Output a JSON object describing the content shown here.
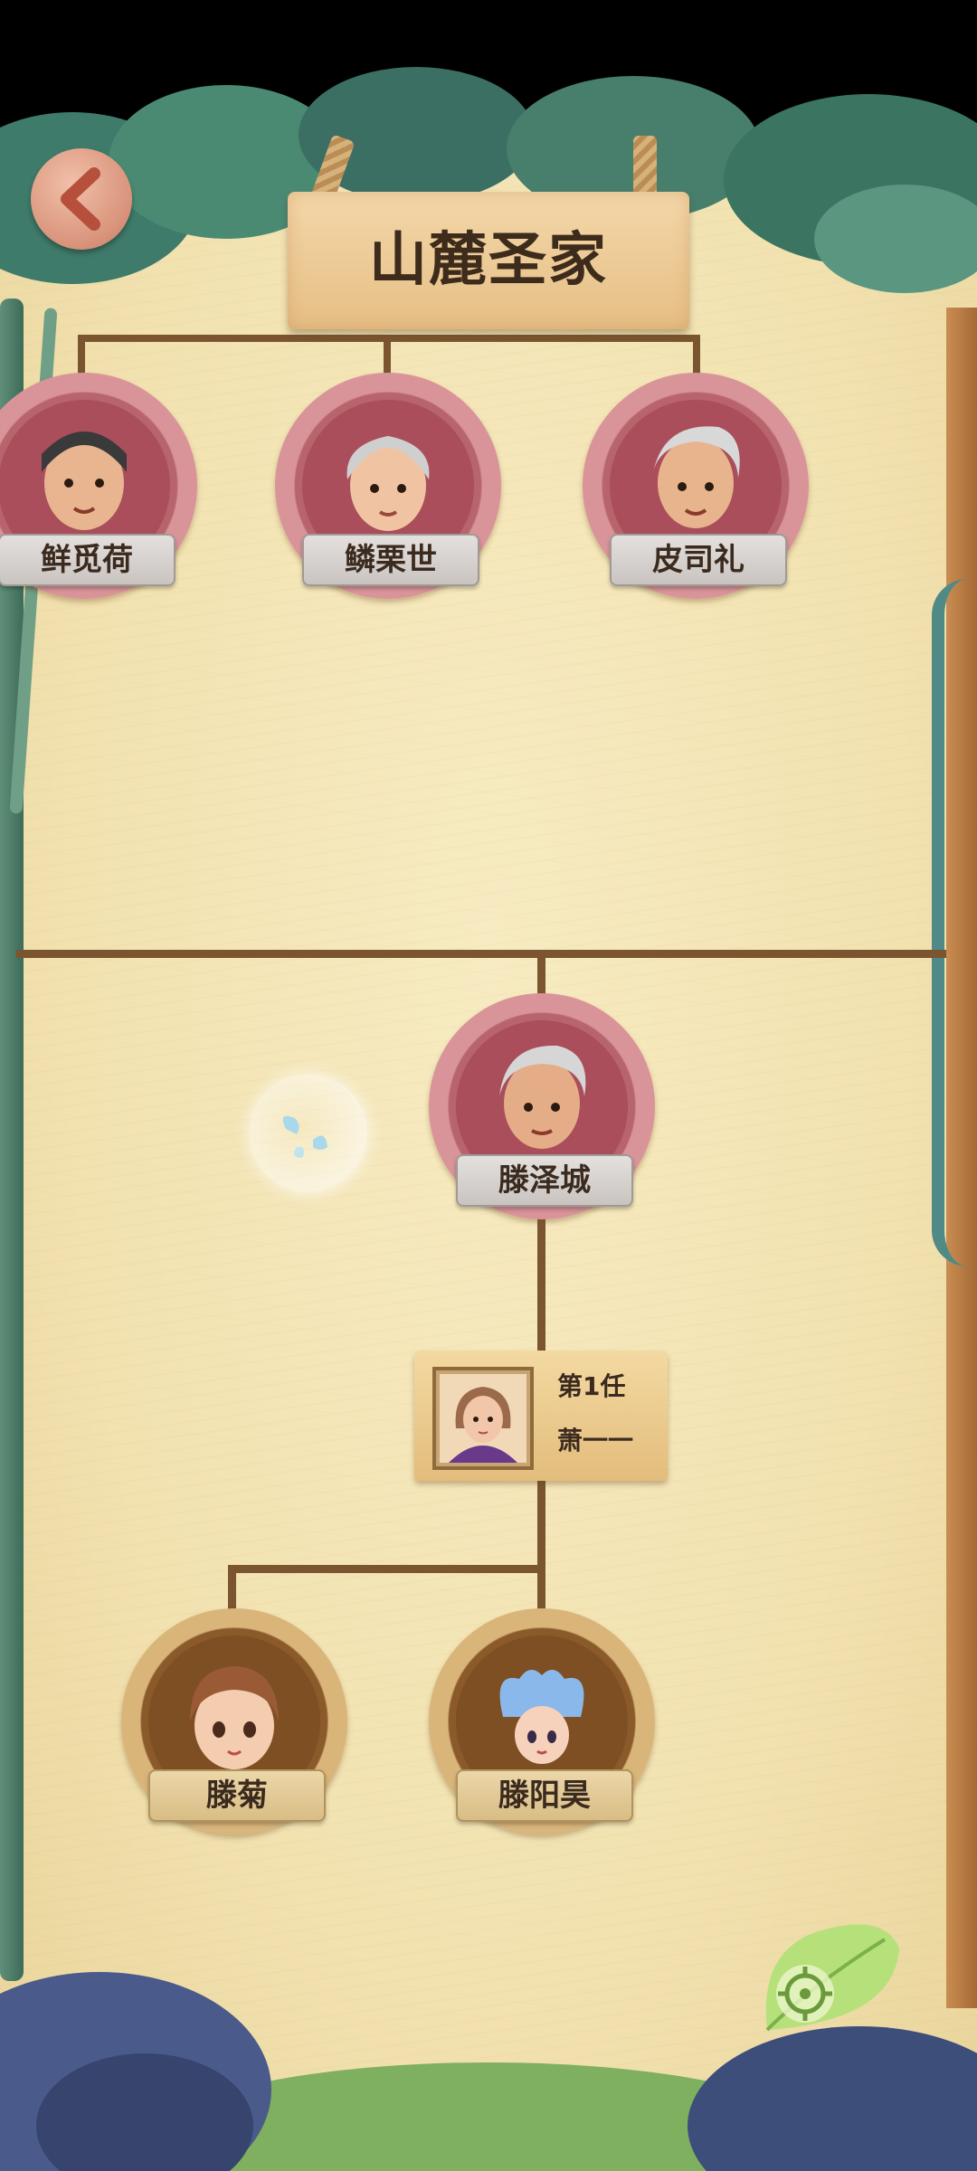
{
  "header": {
    "title": "山麓圣家"
  },
  "back_button": {
    "icon": "back-arrow-icon"
  },
  "grandparents": [
    {
      "name": "鲜觅荷"
    },
    {
      "name": "鳞栗世"
    },
    {
      "name": "皮司礼"
    }
  ],
  "parent": {
    "name": "滕泽城"
  },
  "spouse": {
    "order": "第1任",
    "name": "萧一一"
  },
  "children": [
    {
      "name": "滕菊"
    },
    {
      "name": "滕阳昊"
    }
  ],
  "locate_button": {
    "icon": "target-icon"
  },
  "colors": {
    "tree_line": "#7a5530",
    "elder_ring": "#c97a82",
    "child_ring": "#c89b5a",
    "parchment": "#f2e2b0"
  }
}
